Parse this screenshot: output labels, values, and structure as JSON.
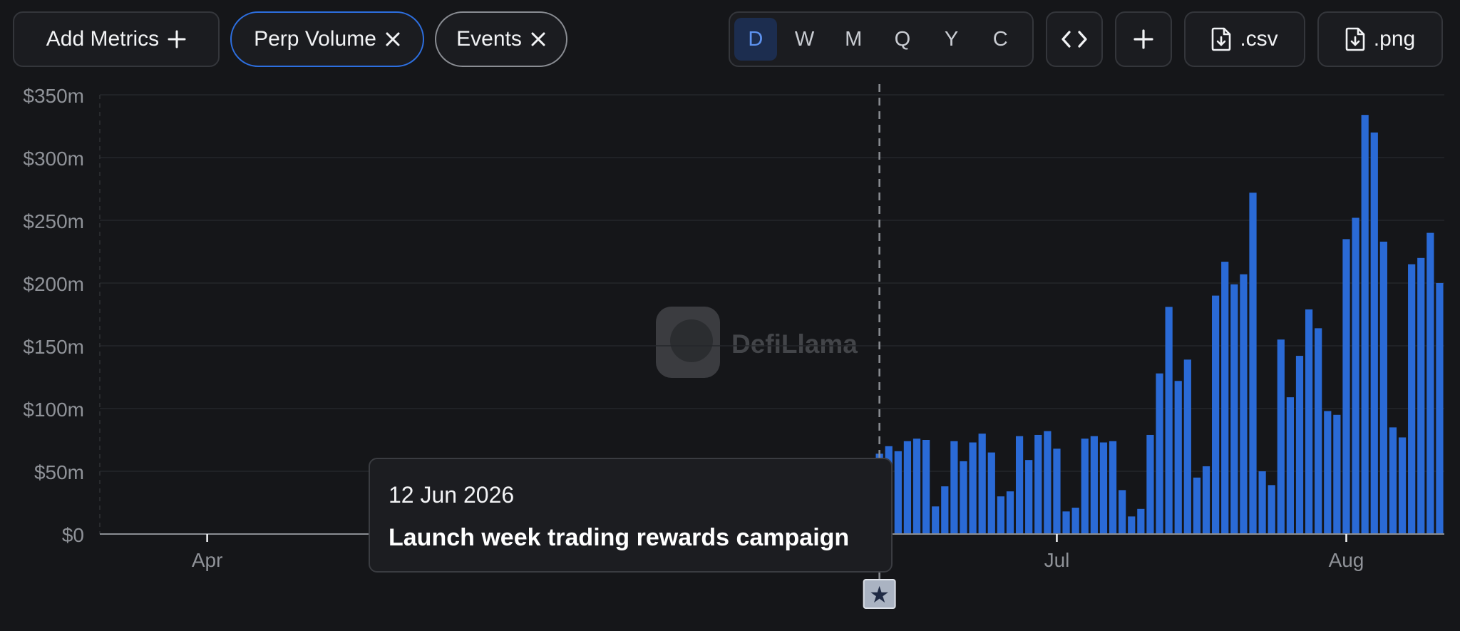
{
  "toolbar": {
    "add_metrics_label": "Add Metrics",
    "metric_pills": [
      {
        "label": "Perp Volume"
      },
      {
        "label": "Events"
      }
    ],
    "periods": [
      "D",
      "W",
      "M",
      "Q",
      "Y",
      "C"
    ],
    "selected_period": "D",
    "embed_icon": "code-icon",
    "add_icon": "plus-icon",
    "csv_label": ".csv",
    "png_label": ".png"
  },
  "watermark": {
    "text": "DefiLlama"
  },
  "tooltip": {
    "date": "12 Jun 2026",
    "title": "Launch week trading rewards campaign"
  },
  "colors": {
    "bar": "#2a6ad6",
    "accent": "#2d6fe0",
    "background": "#151619"
  },
  "chart_data": {
    "type": "bar",
    "series": [
      {
        "values": [
          0,
          0,
          0,
          0,
          0,
          0,
          0,
          0,
          0,
          0,
          0,
          0,
          0,
          0,
          0,
          0,
          0,
          0,
          0,
          0,
          0,
          0,
          0,
          0,
          0,
          0,
          0,
          0,
          0,
          0,
          0.5,
          1,
          1.5,
          1,
          1,
          1,
          0.5,
          0,
          1.5,
          1,
          1.5,
          1,
          0.5,
          0,
          0.5,
          1,
          1,
          0.5,
          0,
          0,
          0,
          0,
          0,
          0,
          0,
          0,
          0,
          0,
          0,
          0,
          0,
          0,
          0,
          0,
          0,
          0,
          0,
          0,
          0,
          0,
          0,
          0,
          0,
          0,
          0,
          0,
          0,
          0,
          0,
          0,
          0,
          0,
          28,
          64,
          70,
          66,
          74,
          76,
          75,
          22,
          38,
          74,
          58,
          73,
          80,
          65,
          30,
          34,
          78,
          59,
          79,
          82,
          68,
          18,
          21,
          76,
          78,
          73,
          74,
          35,
          14,
          20,
          79,
          128,
          181,
          122,
          139,
          45,
          54,
          190,
          217,
          199,
          207,
          272,
          50,
          39,
          155,
          109,
          142,
          179,
          164,
          98,
          95,
          235,
          252,
          334,
          320,
          233,
          85,
          77,
          215,
          220,
          240,
          200
        ]
      }
    ],
    "x_start": "2026-03-21",
    "x_end": "2026-08-07",
    "xticks": [
      {
        "label": "Apr",
        "date": "2026-04-01"
      },
      {
        "label": "Jul",
        "date": "2026-07-01"
      },
      {
        "label": "Aug",
        "date": "2026-08-01"
      }
    ],
    "ylim": [
      0,
      350
    ],
    "yticks": [
      0,
      50,
      100,
      150,
      200,
      250,
      300,
      350
    ],
    "ytick_labels": [
      "$0",
      "$50m",
      "$100m",
      "$150m",
      "$200m",
      "$250m",
      "$300m",
      "$350m"
    ],
    "event_date": "2026-06-12",
    "grid": true,
    "legend": "none"
  }
}
